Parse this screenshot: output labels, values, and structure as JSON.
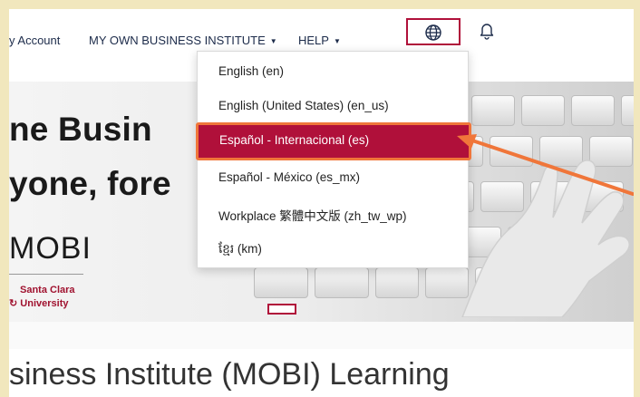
{
  "nav": {
    "account": "y Account",
    "mobi": "MY OWN BUSINESS INSTITUTE",
    "help": "HELP"
  },
  "hero": {
    "line1": "ne Busin",
    "line2": "yone, fore",
    "logo": "MOBI",
    "university_line1": "Santa Clara",
    "university_line2": "University"
  },
  "language_menu": {
    "items": [
      "English (en)",
      "English (United States) (en_us)",
      "Español - Internacional (es)",
      "Español - México (es_mx)",
      "Workplace 繁體中文版 (zh_tw_wp)",
      "ខ្មែរ (km)"
    ],
    "selected_index": 2
  },
  "page": {
    "title": "siness Institute (MOBI) Learning"
  },
  "colors": {
    "accent": "#b0103a",
    "highlight_border": "#f0763a",
    "background_frame": "#f1e7bd"
  },
  "icons": {
    "language": "globe-icon",
    "notifications": "bell-icon",
    "annotation": "arrow-icon"
  }
}
